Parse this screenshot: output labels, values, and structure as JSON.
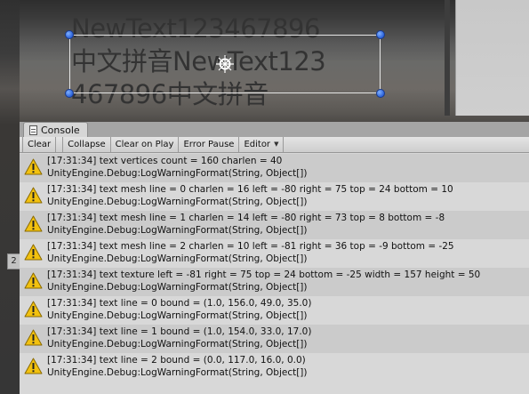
{
  "scene": {
    "text_lines": [
      "NewText123467896",
      "中文拼音NewText123",
      "467896中文拼音"
    ],
    "side_tab_label": "2"
  },
  "console": {
    "tab_label": "Console",
    "toolbar": {
      "clear": "Clear",
      "collapse": "Collapse",
      "clear_on_play": "Clear on Play",
      "error_pause": "Error Pause",
      "editor": "Editor"
    },
    "warning_color": "#f2c10f",
    "entries": [
      {
        "line1": "[17:31:34] text vertices count = 160 charlen = 40",
        "line2": "UnityEngine.Debug:LogWarningFormat(String, Object[])"
      },
      {
        "line1": "[17:31:34] text mesh line = 0 charlen = 16 left = -80 right = 75 top = 24 bottom = 10",
        "line2": "UnityEngine.Debug:LogWarningFormat(String, Object[])"
      },
      {
        "line1": "[17:31:34] text mesh line = 1 charlen = 14 left = -80 right = 73 top = 8 bottom = -8",
        "line2": "UnityEngine.Debug:LogWarningFormat(String, Object[])"
      },
      {
        "line1": "[17:31:34] text mesh line = 2 charlen = 10 left = -81 right = 36 top = -9 bottom = -25",
        "line2": "UnityEngine.Debug:LogWarningFormat(String, Object[])"
      },
      {
        "line1": "[17:31:34] text texture left = -81 right = 75 top = 24 bottom = -25 width = 157 height = 50",
        "line2": "UnityEngine.Debug:LogWarningFormat(String, Object[])"
      },
      {
        "line1": "[17:31:34] text line = 0 bound = (1.0, 156.0, 49.0, 35.0)",
        "line2": "UnityEngine.Debug:LogWarningFormat(String, Object[])"
      },
      {
        "line1": "[17:31:34] text line = 1 bound = (1.0, 154.0, 33.0, 17.0)",
        "line2": "UnityEngine.Debug:LogWarningFormat(String, Object[])"
      },
      {
        "line1": "[17:31:34] text line = 2 bound = (0.0, 117.0, 16.0, 0.0)",
        "line2": "UnityEngine.Debug:LogWarningFormat(String, Object[])"
      }
    ]
  }
}
